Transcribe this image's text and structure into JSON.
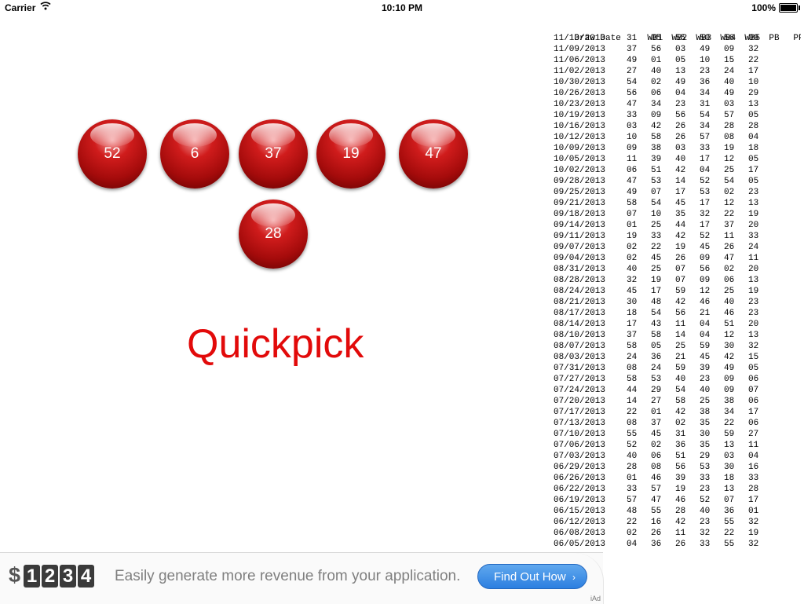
{
  "status_bar": {
    "carrier": "Carrier",
    "time": "10:10 PM",
    "battery": "100%"
  },
  "balls": {
    "white": [
      "52",
      "6",
      "37",
      "19",
      "47"
    ],
    "powerball": "28"
  },
  "title": "Quickpick",
  "table": {
    "headers": [
      "Draw Date",
      "WB1",
      "WB2",
      "WB3",
      "WB4",
      "WB5",
      "PB",
      "PP"
    ],
    "rows": [
      [
        "11/13/2013",
        "31",
        "05",
        "55",
        "50",
        "56",
        "09",
        ""
      ],
      [
        "11/09/2013",
        "37",
        "56",
        "03",
        "49",
        "09",
        "32",
        ""
      ],
      [
        "11/06/2013",
        "49",
        "01",
        "05",
        "10",
        "15",
        "22",
        ""
      ],
      [
        "11/02/2013",
        "27",
        "40",
        "13",
        "23",
        "24",
        "17",
        ""
      ],
      [
        "10/30/2013",
        "54",
        "02",
        "49",
        "36",
        "40",
        "10",
        ""
      ],
      [
        "10/26/2013",
        "56",
        "06",
        "04",
        "34",
        "49",
        "29",
        ""
      ],
      [
        "10/23/2013",
        "47",
        "34",
        "23",
        "31",
        "03",
        "13",
        ""
      ],
      [
        "10/19/2013",
        "33",
        "09",
        "56",
        "54",
        "57",
        "05",
        ""
      ],
      [
        "10/16/2013",
        "03",
        "42",
        "26",
        "34",
        "28",
        "28",
        ""
      ],
      [
        "10/12/2013",
        "10",
        "58",
        "26",
        "57",
        "08",
        "04",
        ""
      ],
      [
        "10/09/2013",
        "09",
        "38",
        "03",
        "33",
        "19",
        "18",
        ""
      ],
      [
        "10/05/2013",
        "11",
        "39",
        "40",
        "17",
        "12",
        "05",
        ""
      ],
      [
        "10/02/2013",
        "06",
        "51",
        "42",
        "04",
        "25",
        "17",
        ""
      ],
      [
        "09/28/2013",
        "47",
        "53",
        "14",
        "52",
        "54",
        "05",
        ""
      ],
      [
        "09/25/2013",
        "49",
        "07",
        "17",
        "53",
        "02",
        "23",
        ""
      ],
      [
        "09/21/2013",
        "58",
        "54",
        "45",
        "17",
        "12",
        "13",
        ""
      ],
      [
        "09/18/2013",
        "07",
        "10",
        "35",
        "32",
        "22",
        "19",
        ""
      ],
      [
        "09/14/2013",
        "01",
        "25",
        "44",
        "17",
        "37",
        "20",
        ""
      ],
      [
        "09/11/2013",
        "19",
        "33",
        "42",
        "52",
        "11",
        "33",
        ""
      ],
      [
        "09/07/2013",
        "02",
        "22",
        "19",
        "45",
        "26",
        "24",
        ""
      ],
      [
        "09/04/2013",
        "02",
        "45",
        "26",
        "09",
        "47",
        "11",
        ""
      ],
      [
        "08/31/2013",
        "40",
        "25",
        "07",
        "56",
        "02",
        "20",
        ""
      ],
      [
        "08/28/2013",
        "32",
        "19",
        "07",
        "09",
        "06",
        "13",
        ""
      ],
      [
        "08/24/2013",
        "45",
        "17",
        "59",
        "12",
        "25",
        "19",
        ""
      ],
      [
        "08/21/2013",
        "30",
        "48",
        "42",
        "46",
        "40",
        "23",
        ""
      ],
      [
        "08/17/2013",
        "18",
        "54",
        "56",
        "21",
        "46",
        "23",
        ""
      ],
      [
        "08/14/2013",
        "17",
        "43",
        "11",
        "04",
        "51",
        "20",
        ""
      ],
      [
        "08/10/2013",
        "37",
        "58",
        "14",
        "04",
        "12",
        "13",
        ""
      ],
      [
        "08/07/2013",
        "58",
        "05",
        "25",
        "59",
        "30",
        "32",
        ""
      ],
      [
        "08/03/2013",
        "24",
        "36",
        "21",
        "45",
        "42",
        "15",
        ""
      ],
      [
        "07/31/2013",
        "08",
        "24",
        "59",
        "39",
        "49",
        "05",
        ""
      ],
      [
        "07/27/2013",
        "58",
        "53",
        "40",
        "23",
        "09",
        "06",
        ""
      ],
      [
        "07/24/2013",
        "44",
        "29",
        "54",
        "40",
        "09",
        "07",
        ""
      ],
      [
        "07/20/2013",
        "14",
        "27",
        "58",
        "25",
        "38",
        "06",
        ""
      ],
      [
        "07/17/2013",
        "22",
        "01",
        "42",
        "38",
        "34",
        "17",
        ""
      ],
      [
        "07/13/2013",
        "08",
        "37",
        "02",
        "35",
        "22",
        "06",
        ""
      ],
      [
        "07/10/2013",
        "55",
        "45",
        "31",
        "30",
        "59",
        "27",
        ""
      ],
      [
        "07/06/2013",
        "52",
        "02",
        "36",
        "35",
        "13",
        "11",
        ""
      ],
      [
        "07/03/2013",
        "40",
        "06",
        "51",
        "29",
        "03",
        "04",
        ""
      ],
      [
        "06/29/2013",
        "28",
        "08",
        "56",
        "53",
        "30",
        "16",
        ""
      ],
      [
        "06/26/2013",
        "01",
        "46",
        "39",
        "33",
        "18",
        "33",
        ""
      ],
      [
        "06/22/2013",
        "33",
        "57",
        "19",
        "23",
        "13",
        "28",
        ""
      ],
      [
        "06/19/2013",
        "57",
        "47",
        "46",
        "52",
        "07",
        "17",
        ""
      ],
      [
        "06/15/2013",
        "48",
        "55",
        "28",
        "40",
        "36",
        "01",
        ""
      ],
      [
        "06/12/2013",
        "22",
        "16",
        "42",
        "23",
        "55",
        "32",
        ""
      ],
      [
        "06/08/2013",
        "02",
        "26",
        "11",
        "32",
        "22",
        "19",
        ""
      ],
      [
        "06/05/2013",
        "04",
        "36",
        "26",
        "33",
        "55",
        "32",
        ""
      ]
    ]
  },
  "ad": {
    "dollar": "$",
    "digits": [
      "1",
      "2",
      "3",
      "4"
    ],
    "tagline": "Easily generate more revenue from your application.",
    "cta": "Find Out How",
    "cta_icon": "›",
    "badge": "iAd"
  },
  "colors": {
    "ball": "#c00d0d",
    "title": "#e20a0a",
    "cta": "#2c7fe0"
  },
  "icons": {
    "wifi": "wifi-icon",
    "battery": "battery-icon",
    "cta_chevron": "chevron-right-icon"
  }
}
